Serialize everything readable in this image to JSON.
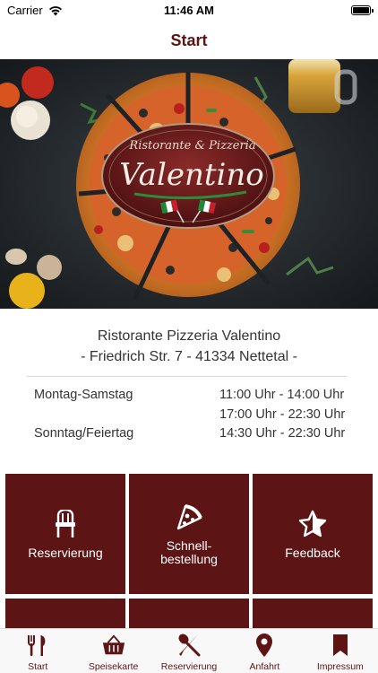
{
  "status_bar": {
    "carrier": "Carrier",
    "time": "11:46 AM"
  },
  "nav": {
    "title": "Start"
  },
  "hero": {
    "logo_top": "Ristorante & Pizzeria",
    "logo_main": "Valentino"
  },
  "info": {
    "name": "Ristorante Pizzeria Valentino",
    "address": "- Friedrich Str. 7 - 41334 Nettetal -",
    "hours": [
      {
        "day": "Montag-Samstag",
        "time": "11:00 Uhr - 14:00 Uhr"
      },
      {
        "day": "",
        "time": "17:00 Uhr - 22:30 Uhr"
      },
      {
        "day": "Sonntag/Feiertag",
        "time": "14:30 Uhr - 22:30 Uhr"
      }
    ]
  },
  "tiles": [
    {
      "label": "Reservierung",
      "icon": "chair-icon"
    },
    {
      "label": "Schnell-\nbestellung",
      "icon": "pizza-slice-icon"
    },
    {
      "label": "Feedback",
      "icon": "star-icon"
    }
  ],
  "tab_bar": [
    {
      "label": "Start",
      "icon": "fork-knife-icon",
      "active": true
    },
    {
      "label": "Speisekarte",
      "icon": "basket-icon",
      "active": false
    },
    {
      "label": "Reservierung",
      "icon": "spoon-knife-icon",
      "active": false
    },
    {
      "label": "Anfahrt",
      "icon": "map-pin-icon",
      "active": false
    },
    {
      "label": "Impressum",
      "icon": "bookmark-icon",
      "active": false
    }
  ],
  "colors": {
    "brand": "#5c1414",
    "nav_title": "#5a1414"
  }
}
